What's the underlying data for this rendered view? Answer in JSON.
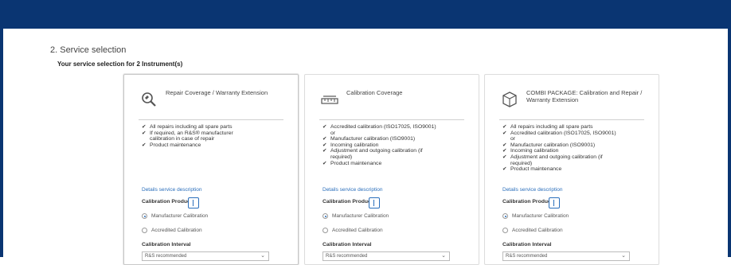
{
  "header": {
    "color": "#0a3572"
  },
  "section": {
    "title": "2. Service selection",
    "subtitle": "Your service selection for 2 Instrument(s)"
  },
  "cards": [
    {
      "icon": "wrench-magnifier-icon",
      "title": "Repair Coverage / Warranty Extension",
      "features": [
        {
          "text": "All repairs including all spare parts",
          "check": true
        },
        {
          "text": "If required, an R&S® manufacturer",
          "check": true
        },
        {
          "text": "calibration in case of repair",
          "check": false
        },
        {
          "text": "Product maintenance",
          "check": true
        }
      ],
      "details_link": "Details service description",
      "calibration_label": "Calibration Product",
      "radio_manufacturer": "Manufacturer Calibration",
      "radio_accredited": "Accredited Calibration",
      "interval_label": "Calibration Interval",
      "interval_value": "R&S recommended"
    },
    {
      "icon": "calibration-ruler-icon",
      "title": "Calibration Coverage",
      "features": [
        {
          "text": "Accredited calibration (ISO17025, ISO9001)",
          "check": true
        },
        {
          "text": "or",
          "check": false
        },
        {
          "text": "Manufacturer calibration (ISO9001)",
          "check": true
        },
        {
          "text": "Incoming calibration",
          "check": true
        },
        {
          "text": "Adjustment and outgoing calibration (if",
          "check": true
        },
        {
          "text": "required)",
          "check": false
        },
        {
          "text": "Product maintenance",
          "check": true
        }
      ],
      "details_link": "Details service description",
      "calibration_label": "Calibration Product",
      "radio_manufacturer": "Manufacturer Calibration",
      "radio_accredited": "Accredited Calibration",
      "interval_label": "Calibration Interval",
      "interval_value": "R&S recommended"
    },
    {
      "icon": "package-box-icon",
      "title": "COMBI PACKAGE: Calibration and Repair / Warranty Extension",
      "features": [
        {
          "text": "All repairs including all spare parts",
          "check": true
        },
        {
          "text": "Accredited calibration (ISO17025, ISO9001)",
          "check": true
        },
        {
          "text": "or",
          "check": false
        },
        {
          "text": "Manufacturer calibration (ISO9001)",
          "check": true
        },
        {
          "text": "Incoming calibration",
          "check": true
        },
        {
          "text": "Adjustment and outgoing calibration (if",
          "check": true
        },
        {
          "text": "required)",
          "check": false
        },
        {
          "text": "Product maintenance",
          "check": true
        }
      ],
      "details_link": "Details service description",
      "calibration_label": "Calibration Product",
      "radio_manufacturer": "Manufacturer Calibration",
      "radio_accredited": "Accredited Calibration",
      "interval_label": "Calibration Interval",
      "interval_value": "R&S recommended"
    }
  ]
}
